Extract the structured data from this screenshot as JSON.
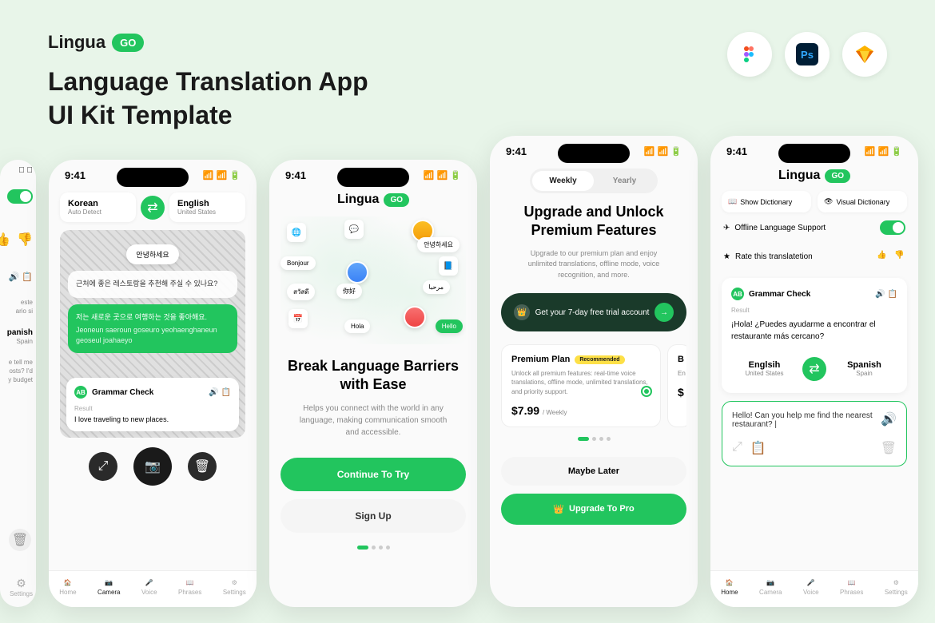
{
  "header": {
    "logo_text": "Lingua",
    "logo_badge": "GO",
    "title_line1": "Language Translation App",
    "title_line2": "UI Kit Template"
  },
  "status": {
    "time": "9:41",
    "signal": "􀙇 􀛨"
  },
  "camera_screen": {
    "lang_from": "Korean",
    "lang_from_sub": "Auto Detect",
    "lang_to": "English",
    "lang_to_sub": "United States",
    "bubble1": "안녕하세요",
    "bubble2": "근처에 좋은 레스토랑을 추천해 주실 수 있나요?",
    "bubble3_line1": "저는 새로운 곳으로 여행하는 것을 좋아해요.",
    "bubble3_line2": "Jeoneun saeroun goseuro yeohaenghaneun geoseul joahaeyo",
    "grammar_label": "Grammar Check",
    "result_label": "Result",
    "result_text": "I love traveling to new places."
  },
  "nav": {
    "home": "Home",
    "camera": "Camera",
    "voice": "Voice",
    "phrases": "Phrases",
    "settings": "Settings"
  },
  "onboard": {
    "logo_text": "Lingua",
    "logo_badge": "GO",
    "bubbles": {
      "korean": "안녕하세요",
      "bonjour": "Bonjour",
      "thai": "สวัสดี",
      "chinese": "你好",
      "arabic": "مرحبا",
      "hola": "Hola",
      "hello": "Hello"
    },
    "title": "Break Language Barriers with Ease",
    "desc": "Helps you connect with the world in any language, making communication smooth and accessible.",
    "btn_primary": "Continue To Try",
    "btn_secondary": "Sign Up"
  },
  "upgrade": {
    "tab_weekly": "Weekly",
    "tab_yearly": "Yearly",
    "title": "Upgrade and Unlock Premium Features",
    "desc": "Upgrade to our premium plan and enjoy unlimited translations, offline mode, voice recognition, and more.",
    "trial_text": "Get your 7-day free trial account",
    "plan_name": "Premium Plan",
    "recommended": "Recommended",
    "plan_desc": "Unlock all premium features: real-time voice translations, offline mode, unlimited translations, and priority support.",
    "price": "$7.99",
    "period": "/ Weekly",
    "plan2_name": "B",
    "plan2_desc": "En",
    "plan2_price": "$",
    "maybe": "Maybe Later",
    "upgrade_btn": "Upgrade To Pro"
  },
  "home_screen": {
    "logo_text": "Lingua",
    "logo_badge": "GO",
    "show_dict": "Show Dictionary",
    "visual_dict": "Visual Dictionary",
    "offline": "Offline Language Support",
    "rate": "Rate this translatetion",
    "grammar": "Grammar Check",
    "result_label": "Result",
    "result_text": "¡Hola! ¿Puedes ayudarme a encontrar el restaurante más cercano?",
    "lang_from": "Englsih",
    "lang_from_sub": "United States",
    "lang_to": "Spanish",
    "lang_to_sub": "Spain",
    "input_text": "Hello! Can you help me find the nearest restaurant? |"
  },
  "partial_left": {
    "text1": "este",
    "text2": "ario si",
    "lang": "panish",
    "lang_sub": "Spain",
    "text3": "e tell me",
    "text4": "osts? I'd",
    "text5": "y budget"
  }
}
